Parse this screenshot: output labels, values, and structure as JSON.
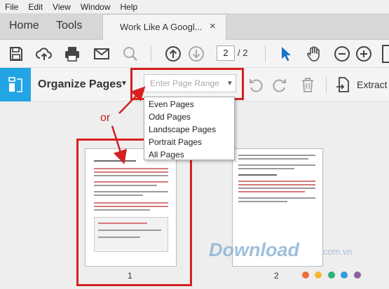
{
  "menu": [
    "File",
    "Edit",
    "View",
    "Window",
    "Help"
  ],
  "tabs": {
    "home": "Home",
    "tools": "Tools",
    "document": "Work Like A Googl...",
    "close": "×"
  },
  "toolbar": {
    "icons": [
      "save-icon",
      "upload-icon",
      "print-icon",
      "mail-icon",
      "search-icon",
      "page-up-icon",
      "page-down-icon",
      "cursor-icon",
      "hand-icon",
      "zoom-out-icon",
      "zoom-in-icon"
    ],
    "current_page": "2",
    "total_pages": "/ 2"
  },
  "organize": {
    "title": "Organize Pages",
    "range_placeholder": "Enter Page Range",
    "extract_label": "Extract",
    "accent": "#22a4e5"
  },
  "dropdown": {
    "options": [
      "Even Pages",
      "Odd Pages",
      "Landscape Pages",
      "Portrait Pages",
      "All Pages"
    ]
  },
  "annotation": {
    "or_label": "or",
    "color": "#d62020"
  },
  "thumbnails": [
    {
      "page_number": "1"
    },
    {
      "page_number": "2"
    }
  ],
  "watermark": {
    "brand": "Download",
    "suffix": ".com.vn",
    "dot_colors": [
      "#f26b3a",
      "#f7b733",
      "#2bb673",
      "#2b9de0",
      "#8e5ea2"
    ]
  }
}
